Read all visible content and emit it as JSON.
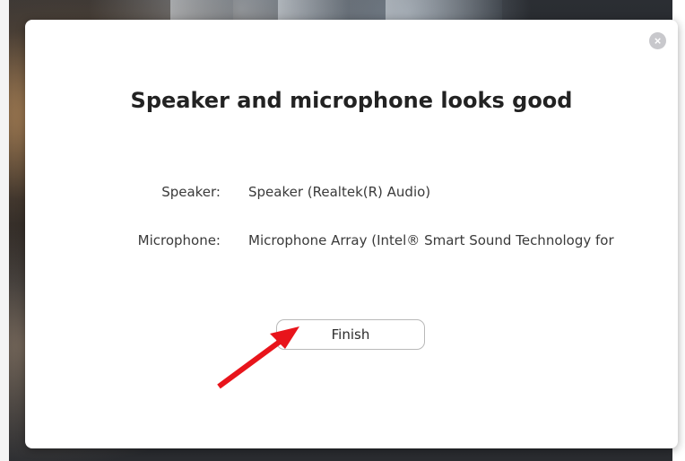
{
  "dialog": {
    "title": "Speaker and microphone looks good",
    "close_icon": "close-icon",
    "close_glyph": "×",
    "speaker_label": "Speaker:",
    "speaker_value": "Speaker (Realtek(R) Audio)",
    "microphone_label": "Microphone:",
    "microphone_value": "Microphone Array (Intel® Smart Sound Technology for Digital Microphones)",
    "finish_label": "Finish"
  },
  "annotation": {
    "arrow_color": "#e8141b",
    "arrow_icon": "red-arrow-annotation"
  },
  "colors": {
    "title": "#222222",
    "text": "#3a3a3a",
    "button_border": "#b9b9b9",
    "close_button": "#c8c8cc"
  }
}
